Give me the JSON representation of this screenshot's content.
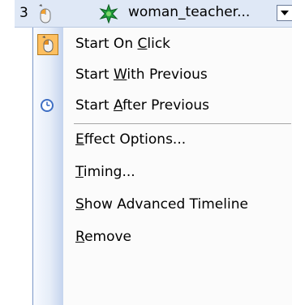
{
  "item_bar": {
    "number": "3",
    "name": "woman_teacher...",
    "mouse_icon": "mouse-icon",
    "effect_icon": "green-star-effect-icon",
    "dropdown_icon": "chevron-down-icon"
  },
  "menu": {
    "items": [
      {
        "id": "start-on-click",
        "pre": "Start On ",
        "accel": "C",
        "post": "lick",
        "icon": "mouse-icon",
        "checked": true
      },
      {
        "id": "start-with-previous",
        "pre": "Start ",
        "accel": "W",
        "post": "ith Previous",
        "icon": "",
        "checked": false
      },
      {
        "id": "start-after-previous",
        "pre": "Start ",
        "accel": "A",
        "post": "fter Previous",
        "icon": "clock-icon",
        "checked": false
      },
      {
        "id": "effect-options",
        "pre": "",
        "accel": "E",
        "post": "ffect Options...",
        "icon": "",
        "checked": false
      },
      {
        "id": "timing",
        "pre": "",
        "accel": "T",
        "post": "iming...",
        "icon": "",
        "checked": false
      },
      {
        "id": "show-advanced-timeline",
        "pre": "",
        "accel": "S",
        "post": "how Advanced Timeline",
        "icon": "",
        "checked": false
      },
      {
        "id": "remove",
        "pre": "",
        "accel": "R",
        "post": "emove",
        "icon": "",
        "checked": false
      }
    ]
  },
  "colors": {
    "checked_bg": "#fdbf60",
    "bar_bg": "#dfe8f6",
    "gutter_edge": "#c5d4ee"
  }
}
